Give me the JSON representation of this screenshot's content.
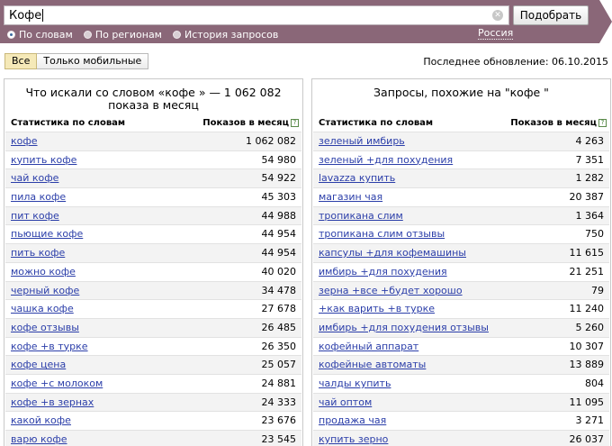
{
  "search": {
    "query": "Кофе",
    "clear_icon": "clear-icon",
    "button_label": "Подобрать"
  },
  "modes": [
    {
      "label": "По словам",
      "selected": true
    },
    {
      "label": "По регионам",
      "selected": false
    },
    {
      "label": "История запросов",
      "selected": false
    }
  ],
  "region": "Россия",
  "filters": [
    {
      "label": "Все",
      "active": true
    },
    {
      "label": "Только мобильные",
      "active": false
    }
  ],
  "last_update": "Последнее обновление: 06.10.2015",
  "left_panel": {
    "title_line1": "Что искали со словом «кофе » — 1 062 082",
    "title_line2": "показа в месяц",
    "col_words": "Статистика по словам",
    "col_shows": "Показов в месяц",
    "rows": [
      {
        "phrase": "кофе",
        "count": "1 062 082"
      },
      {
        "phrase": "купить кофе",
        "count": "54 980"
      },
      {
        "phrase": "чай кофе",
        "count": "54 922"
      },
      {
        "phrase": "пила кофе",
        "count": "45 303"
      },
      {
        "phrase": "пит кофе",
        "count": "44 988"
      },
      {
        "phrase": "пьющие кофе",
        "count": "44 954"
      },
      {
        "phrase": "пить кофе",
        "count": "44 954"
      },
      {
        "phrase": "можно кофе",
        "count": "40 020"
      },
      {
        "phrase": "черный кофе",
        "count": "34 478"
      },
      {
        "phrase": "чашка кофе",
        "count": "27 678"
      },
      {
        "phrase": "кофе отзывы",
        "count": "26 485"
      },
      {
        "phrase": "кофе +в турке",
        "count": "26 350"
      },
      {
        "phrase": "кофе цена",
        "count": "25 057"
      },
      {
        "phrase": "кофе +с молоком",
        "count": "24 881"
      },
      {
        "phrase": "кофе +в зернах",
        "count": "24 333"
      },
      {
        "phrase": "какой кофе",
        "count": "23 676"
      },
      {
        "phrase": "варю кофе",
        "count": "23 545"
      }
    ]
  },
  "right_panel": {
    "title": "Запросы, похожие на \"кофе \"",
    "col_words": "Статистика по словам",
    "col_shows": "Показов в месяц",
    "rows": [
      {
        "phrase": "зеленый имбирь",
        "count": "4 263"
      },
      {
        "phrase": "зеленый +для похудения",
        "count": "7 351"
      },
      {
        "phrase": "lavazza купить",
        "count": "1 282"
      },
      {
        "phrase": "магазин чая",
        "count": "20 387"
      },
      {
        "phrase": "тропикана слим",
        "count": "1 364"
      },
      {
        "phrase": "тропикана слим отзывы",
        "count": "750"
      },
      {
        "phrase": "капсулы +для кофемашины",
        "count": "11 615"
      },
      {
        "phrase": "имбирь +для похудения",
        "count": "21 251"
      },
      {
        "phrase": "зерна +все +будет хорошо",
        "count": "79"
      },
      {
        "phrase": "+как варить +в турке",
        "count": "11 240"
      },
      {
        "phrase": "имбирь +для похудения отзывы",
        "count": "5 260"
      },
      {
        "phrase": "кофейный аппарат",
        "count": "10 307"
      },
      {
        "phrase": "кофейные автоматы",
        "count": "13 889"
      },
      {
        "phrase": "чалды купить",
        "count": "804"
      },
      {
        "phrase": "чай оптом",
        "count": "11 095"
      },
      {
        "phrase": "продажа чая",
        "count": "3 271"
      },
      {
        "phrase": "купить зерно",
        "count": "26 037"
      }
    ]
  },
  "colors": {
    "header_band": "#8a6778",
    "link": "#2b3ea9",
    "active_filter": "#f5e9b8"
  }
}
